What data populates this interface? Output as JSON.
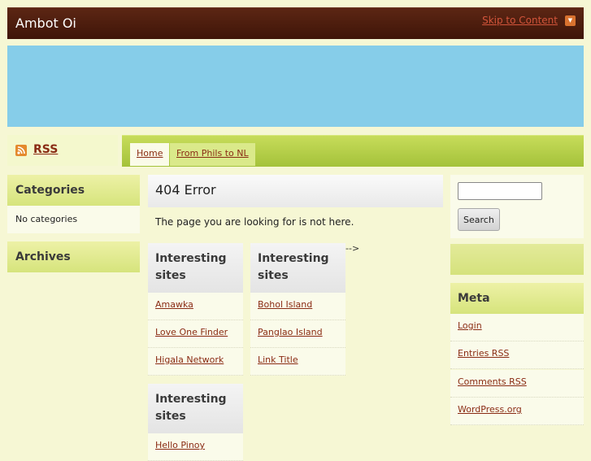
{
  "header": {
    "site_title": "Ambot Oi",
    "skip_link": "Skip to Content"
  },
  "colors": {
    "header_bg": "#4a1c0c",
    "banner_bg": "#86cde9",
    "nav_green": "#b5d04a",
    "link": "#8a2b14",
    "page_bg": "#f6f7d4"
  },
  "rss": {
    "label": "RSS",
    "icon": "rss-icon"
  },
  "nav": {
    "tabs": [
      {
        "label": "Home",
        "active": true
      },
      {
        "label": "From Phils to NL",
        "active": false
      }
    ]
  },
  "sidebar_left": {
    "categories": {
      "title": "Categories",
      "empty_text": "No categories"
    },
    "archives": {
      "title": "Archives"
    }
  },
  "main": {
    "title": "404 Error",
    "message": "The page you are looking for is not here.",
    "stray_text": "-->",
    "link_boxes": [
      {
        "title": "Interesting sites",
        "links": [
          "Amawka",
          "Love One Finder",
          "Higala Network"
        ]
      },
      {
        "title": "Interesting sites",
        "links": [
          "Bohol Island",
          "Panglao Island",
          "Link Title"
        ]
      },
      {
        "title": "Interesting sites",
        "links": [
          "Hello Pinoy"
        ]
      }
    ]
  },
  "sidebar_right": {
    "search": {
      "button_label": "Search",
      "input_value": ""
    },
    "meta": {
      "title": "Meta",
      "links": [
        "Login",
        "Entries RSS",
        "Comments RSS",
        "WordPress.org"
      ]
    }
  }
}
